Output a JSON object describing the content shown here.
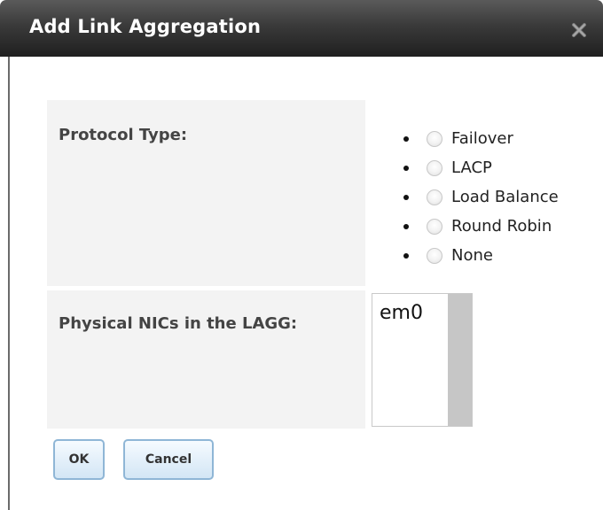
{
  "dialog": {
    "title": "Add Link Aggregation",
    "close_icon": "close-x-icon"
  },
  "protocol": {
    "label": "Protocol Type:",
    "options": [
      "Failover",
      "LACP",
      "Load Balance",
      "Round Robin",
      "None"
    ],
    "selected": null
  },
  "nics": {
    "label": "Physical NICs in the LAGG:",
    "options": [
      "em0"
    ]
  },
  "buttons": {
    "ok": "OK",
    "cancel": "Cancel"
  },
  "colors": {
    "titlebar": "#2b2b2b",
    "row_background": "#f3f3f3",
    "button_border": "#8fb6d6"
  }
}
